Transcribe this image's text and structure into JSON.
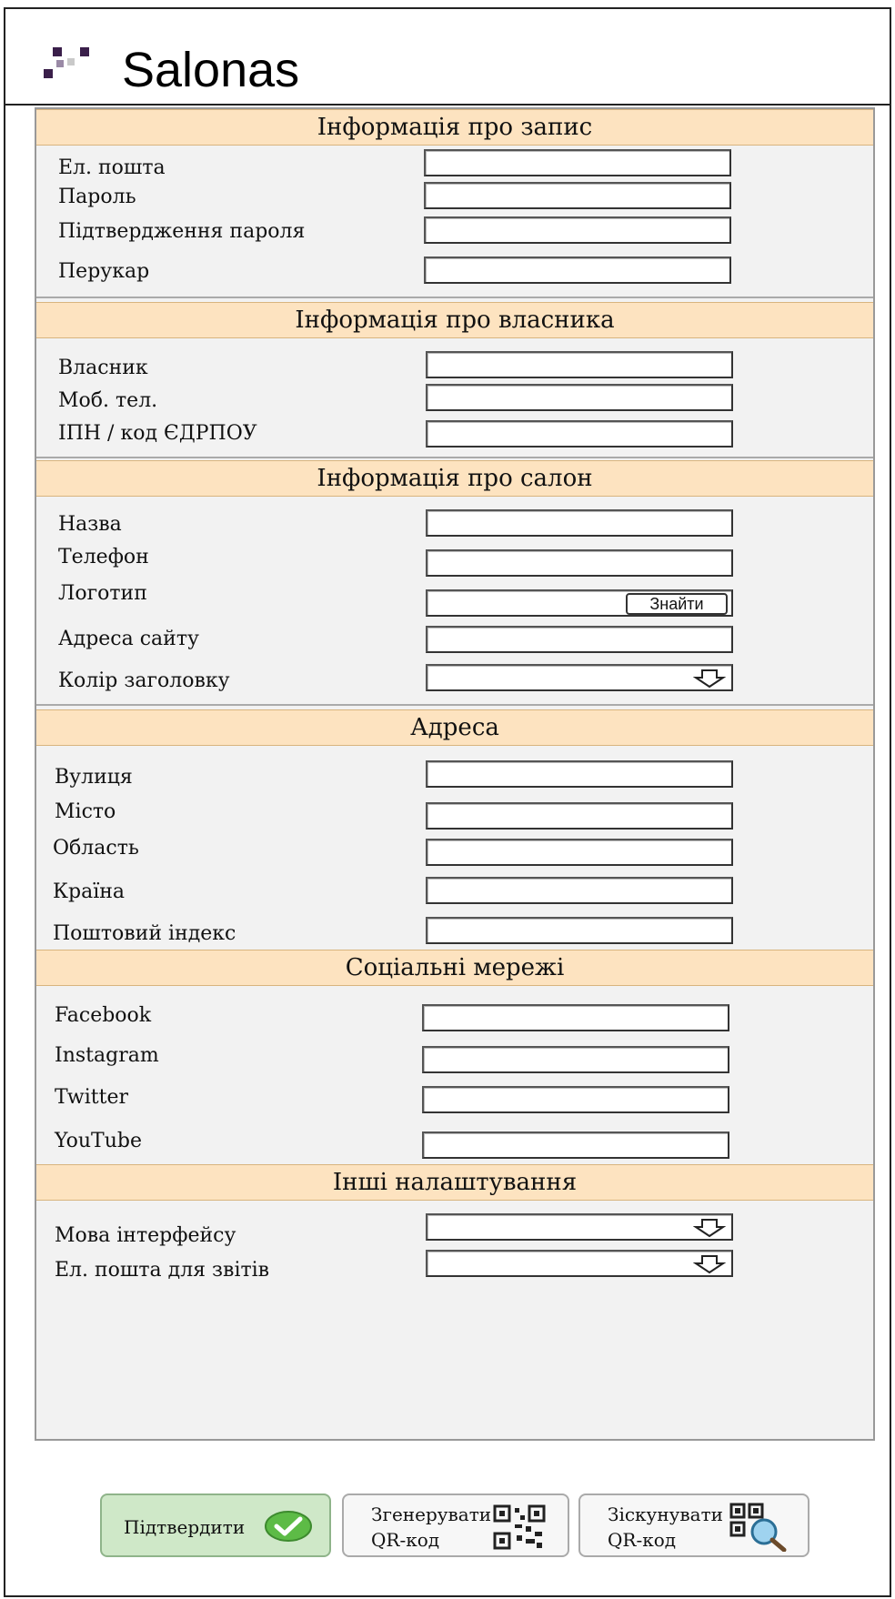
{
  "app": {
    "title": "Salonas"
  },
  "sections": {
    "account": {
      "title": "Інформація про запис",
      "fields": [
        "Ел. пошта",
        "Пароль",
        "Підтвердження пароля",
        "Перукар"
      ]
    },
    "owner": {
      "title": "Інформація про власника",
      "fields": [
        "Власник",
        "Моб. тел.",
        "ІПН / код ЄДРПОУ"
      ]
    },
    "salon": {
      "title": "Інформація про салон",
      "fields": [
        "Назва",
        "Телефон",
        "Логотип",
        "Адреса сайту",
        "Колір заголовку"
      ],
      "find_button": "Знайти"
    },
    "address": {
      "title": "Адреса",
      "fields": [
        "Вулиця",
        "Місто",
        "Область",
        "Країна",
        "Поштовий індекс"
      ]
    },
    "social": {
      "title": "Соціальні мережі",
      "fields": [
        "Facebook",
        "Instagram",
        "Twitter",
        "YouTube"
      ]
    },
    "other": {
      "title": "Інші налаштування",
      "fields": [
        "Мова інтерфейсу",
        "Ел. пошта для звітів"
      ]
    }
  },
  "buttons": {
    "confirm": "Підтвердити",
    "generate_line1": "Згенерувати",
    "generate_line2": "QR-код",
    "scan_line1": "Зіскунувати",
    "scan_line2": "QR-код"
  },
  "icons": {
    "logo": "salonas-dots-logo",
    "confirm": "green-checkmark-icon",
    "generate": "qr-code-icon",
    "scan": "qr-scan-magnifier-icon",
    "dropdown": "outline-down-arrow-icon"
  },
  "colors": {
    "section_header": "#fde3c0",
    "form_background": "#f2f2f2",
    "confirm_button": "#cfe8c8"
  }
}
